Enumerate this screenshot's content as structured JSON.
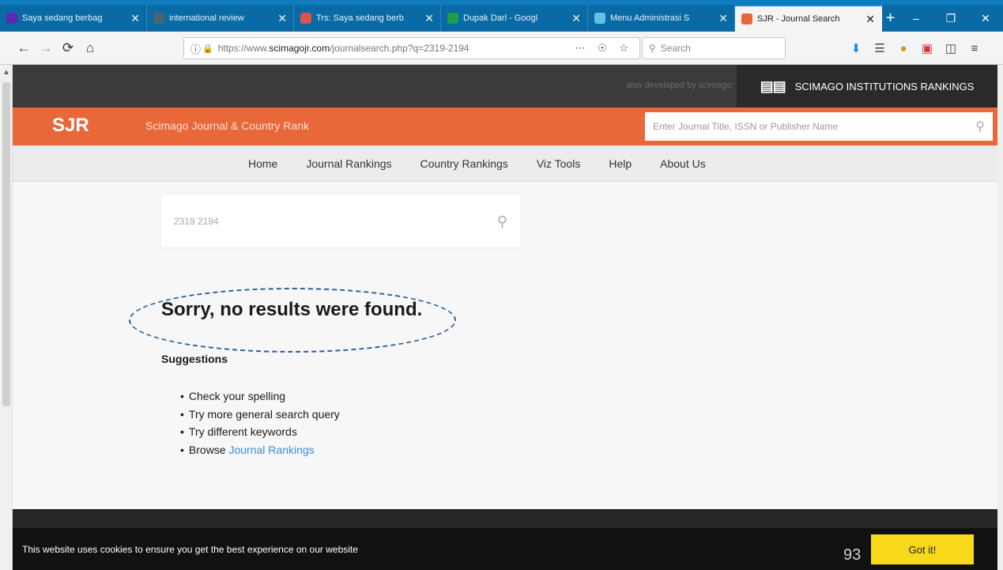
{
  "browser": {
    "tabs": [
      {
        "title": "Saya sedang berbag",
        "favicon_color": "#5b2ab5",
        "active": false
      },
      {
        "title": "international review",
        "favicon_color": "#4a6470",
        "active": false
      },
      {
        "title": "Trs: Saya sedang berb",
        "favicon_color": "#d9534f",
        "active": false
      },
      {
        "title": "Dupak Darl - Googl",
        "favicon_color": "#1e9e4a",
        "active": false
      },
      {
        "title": "Menu Administrasi S",
        "favicon_color": "#62c0e9",
        "active": false
      },
      {
        "title": "SJR - Journal Search",
        "favicon_color": "#e8683a",
        "active": true
      }
    ],
    "url_prefix": "https://www.",
    "url_host": "scimagojr.com",
    "url_path": "/journalsearch.php?q=2319-2194",
    "search_placeholder": "Search"
  },
  "site": {
    "also_developed": "also developed by scimago:",
    "sir_label": "SCIMAGO INSTITUTIONS RANKINGS",
    "logo": "SJR",
    "name": "Scimago Journal & Country Rank",
    "search_placeholder": "Enter Journal Title, ISSN or Publisher Name",
    "menu": [
      "Home",
      "Journal Rankings",
      "Country Rankings",
      "Viz Tools",
      "Help",
      "About Us"
    ]
  },
  "main": {
    "query": "2319 2194",
    "no_results": "Sorry, no results were found.",
    "suggestions_title": "Suggestions",
    "suggestions": [
      "Check your spelling",
      "Try more general search query",
      "Try different keywords"
    ],
    "browse_prefix": "Browse",
    "browse_link": "Journal Rankings"
  },
  "cookie": {
    "message": "This website uses cookies to ensure you get the best experience on our website",
    "button": "Got it!"
  },
  "slide_number": "93",
  "colors": {
    "accent_orange": "#e8683a",
    "cookie_button": "#f7d81a",
    "link_blue": "#3a8fd6",
    "annotation_ellipse": "#2a5d9c"
  }
}
